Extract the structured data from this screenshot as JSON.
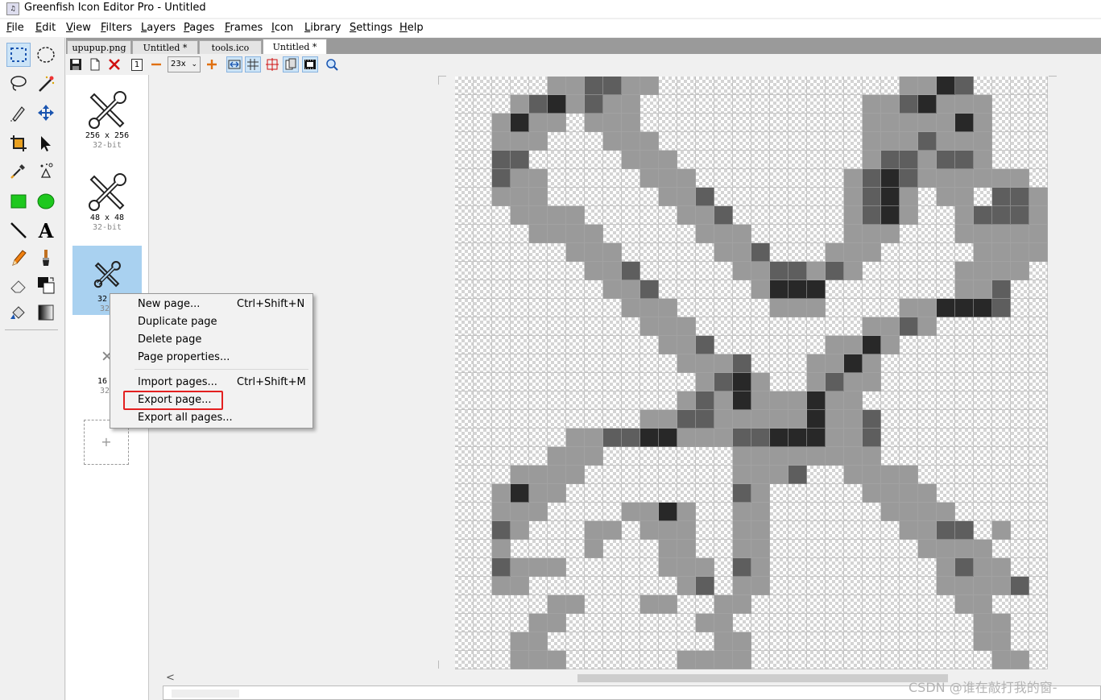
{
  "window": {
    "title": "Greenfish Icon Editor Pro - Untitled"
  },
  "menu": [
    "File",
    "Edit",
    "View",
    "Filters",
    "Layers",
    "Pages",
    "Frames",
    "Icon",
    "Library",
    "Settings",
    "Help"
  ],
  "tabs": [
    {
      "label": "upupup.png"
    },
    {
      "label": "Untitled *"
    },
    {
      "label": "tools.ico"
    },
    {
      "label": "Untitled *",
      "active": true
    }
  ],
  "doc_toolbar": {
    "zoom": "23x",
    "page_number_icon": "1"
  },
  "tools": [
    "select-rect-icon",
    "select-ellipse-icon",
    "lasso-icon",
    "magic-wand-icon",
    "pen-path-icon",
    "move-icon",
    "crop-icon",
    "pointer-icon",
    "eyedropper-icon",
    "color-replace-icon",
    "rectangle-icon",
    "ellipse-icon",
    "line-icon",
    "text-icon",
    "pencil-icon",
    "brush-icon",
    "eraser-icon",
    "swap-colors-icon",
    "fill-icon",
    "gradient-icon"
  ],
  "pages": [
    {
      "size": "256 x 256",
      "bits": "32-bit"
    },
    {
      "size": "48 x 48",
      "bits": "32-bit"
    },
    {
      "size": "32 x",
      "bits": "32-",
      "selected": true
    },
    {
      "size": "16 x",
      "bits": "32-"
    }
  ],
  "add_page_label": "+",
  "context_menu": [
    {
      "label": "New page...",
      "shortcut": "Ctrl+Shift+N"
    },
    {
      "label": "Duplicate page",
      "shortcut": ""
    },
    {
      "label": "Delete page",
      "shortcut": ""
    },
    {
      "label": "Page properties...",
      "shortcut": ""
    },
    {
      "label": "Import pages...",
      "shortcut": "Ctrl+Shift+M"
    },
    {
      "label": "Export page...",
      "shortcut": "",
      "highlighted": true
    },
    {
      "label": "Export all pages...",
      "shortcut": ""
    }
  ],
  "canvas": {
    "grid_size": 32,
    "zoom_level": "23x",
    "pixels": [
      ".....332233.............3312....",
      "...3213233............3321333...",
      "..3133.333............3333313...",
      "..333...333...........3332333...",
      "..22.....333..........3223223...",
      "..233.....333........3212333333.",
      "..333......332.......3213.33.223",
      "...3333.....332......3213..32223",
      "....3333.....333.....333...33333",
      "......333.....332...333.....3333",
      ".......332.....3322323.....3333.",
      "........332.....3111.......332..",
      ".........333.....333....331112..",
      "..........333.........3323......",
      "...........332......3313........",
      "............3332...3313.........",
      ".............3213..3233.........",
      "............3231333133..........",
      "..........3322333331332.........",
      "......33221133322111332.........",
      ".....333.......33333333.........",
      "...3333........3332..3333.......",
      "..3133.........23.....3333......",
      "..333....3313..33......3333.....",
      "..23...33.333..33.......3322.3..",
      "..3....3...33..33........3333...",
      "..2333.....333.23.........3233..",
      "..33........32.33.........33332.",
      ".....33...33..33...........33...",
      "....33.......33.............33..",
      "...33.........33............33..",
      "...333......3333.............33."
    ]
  },
  "scrollbar": {
    "left_arrow": "<"
  },
  "watermark": "CSDN @谁在敲打我的窗-"
}
